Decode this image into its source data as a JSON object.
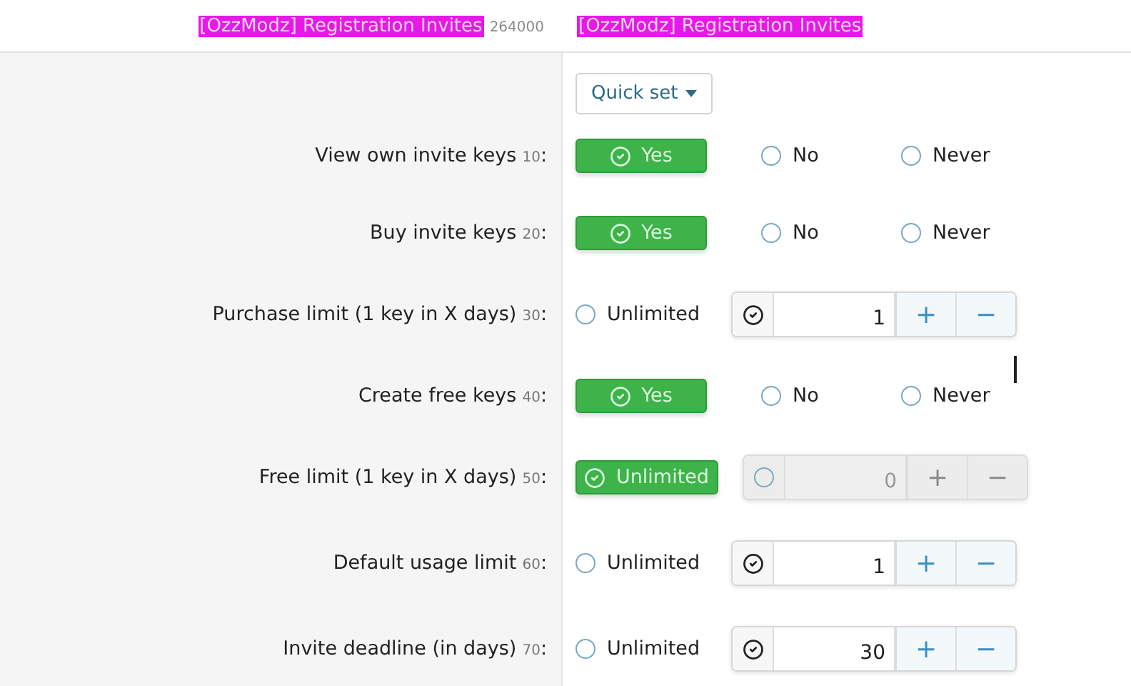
{
  "header": {
    "title": "[OzzModz] Registration Invites",
    "id": "264000",
    "value_title": "[OzzModz] Registration Invites"
  },
  "quick_set": {
    "label": "Quick set"
  },
  "rows": [
    {
      "kind": "choice",
      "label": "View own invite keys",
      "order": "10",
      "colon": ":",
      "options": [
        {
          "label": "Yes",
          "selected": true
        },
        {
          "label": "No",
          "selected": false
        },
        {
          "label": "Never",
          "selected": false
        }
      ]
    },
    {
      "kind": "choice",
      "label": "Buy invite keys",
      "order": "20",
      "colon": ":",
      "options": [
        {
          "label": "Yes",
          "selected": true
        },
        {
          "label": "No",
          "selected": false
        },
        {
          "label": "Never",
          "selected": false
        }
      ]
    },
    {
      "kind": "limit",
      "label": "Purchase limit (1 key in X days)",
      "order": "30",
      "colon": ":",
      "unlimited": {
        "label": "Unlimited",
        "selected": false
      },
      "value": "1",
      "plus": "+",
      "minus": "−"
    },
    {
      "kind": "choice",
      "label": "Create free keys",
      "order": "40",
      "colon": ":",
      "options": [
        {
          "label": "Yes",
          "selected": true
        },
        {
          "label": "No",
          "selected": false
        },
        {
          "label": "Never",
          "selected": false
        }
      ]
    },
    {
      "kind": "limit",
      "label": "Free limit (1 key in X days)",
      "order": "50",
      "colon": ":",
      "unlimited": {
        "label": "Unlimited",
        "selected": true
      },
      "value": "0",
      "plus": "+",
      "minus": "−"
    },
    {
      "kind": "limit",
      "label": "Default usage limit",
      "order": "60",
      "colon": ":",
      "unlimited": {
        "label": "Unlimited",
        "selected": false
      },
      "value": "1",
      "plus": "+",
      "minus": "−"
    },
    {
      "kind": "limit",
      "label": "Invite deadline (in days)",
      "order": "70",
      "colon": ":",
      "unlimited": {
        "label": "Unlimited",
        "selected": false
      },
      "value": "30",
      "plus": "+",
      "minus": "−"
    }
  ]
}
